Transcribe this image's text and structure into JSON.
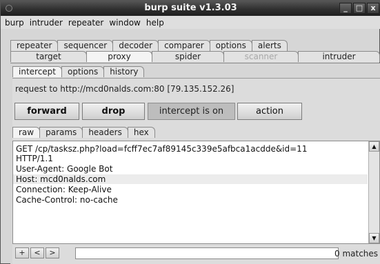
{
  "window": {
    "title": "burp suite v1.3.03",
    "min": "_",
    "max": "□",
    "close": "x"
  },
  "menu": [
    "burp",
    "intruder",
    "repeater",
    "window",
    "help"
  ],
  "tabs_top": [
    "repeater",
    "sequencer",
    "decoder",
    "comparer",
    "options",
    "alerts"
  ],
  "tabs_main": [
    {
      "label": "target",
      "disabled": false
    },
    {
      "label": "proxy",
      "disabled": false,
      "active": true
    },
    {
      "label": "spider",
      "disabled": false
    },
    {
      "label": "scanner",
      "disabled": true
    },
    {
      "label": "intruder",
      "disabled": false
    }
  ],
  "proxy_tabs": [
    "intercept",
    "options",
    "history"
  ],
  "request_info": "request to http://mcd0nalds.com:80  [79.135.152.26]",
  "buttons": {
    "forward": "forward",
    "drop": "drop",
    "intercept": "intercept is on",
    "action": "action"
  },
  "view_tabs": [
    "raw",
    "params",
    "headers",
    "hex"
  ],
  "request_lines": [
    "GET /cp/tasksz.php?load=fcff7ec7af89145c339e5afbca1acdde&id=11",
    "HTTP/1.1",
    "User-Agent: Google Bot",
    "Host: mcd0nalds.com",
    "Connection: Keep-Alive",
    "Cache-Control: no-cache"
  ],
  "search": {
    "prev_add": "+",
    "prev": "<",
    "next": ">",
    "placeholder": "",
    "matches": "0 matches"
  }
}
